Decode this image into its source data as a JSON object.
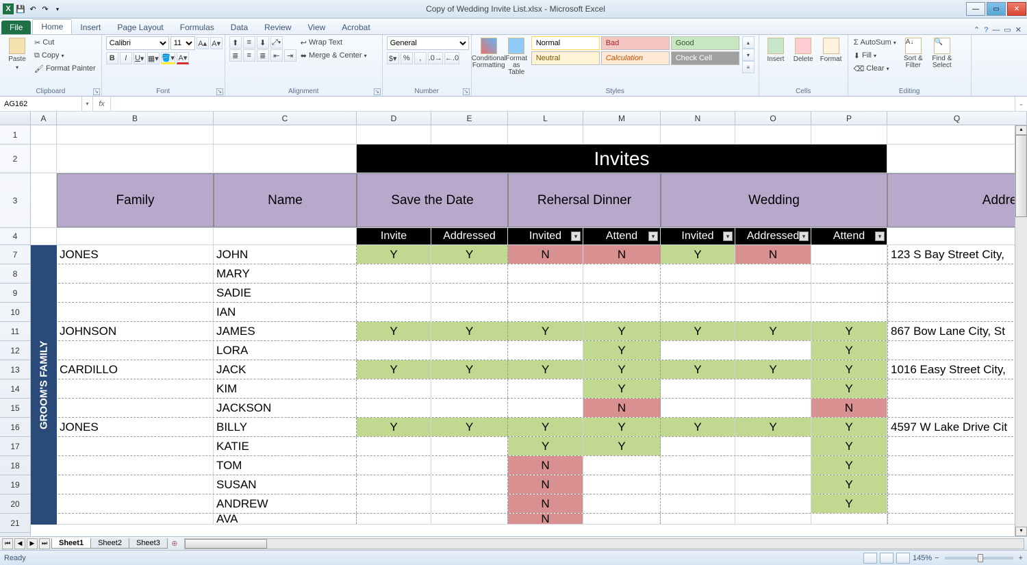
{
  "window": {
    "title": "Copy of Wedding Invite List.xlsx - Microsoft Excel"
  },
  "tabs": {
    "file": "File",
    "list": [
      "Home",
      "Insert",
      "Page Layout",
      "Formulas",
      "Data",
      "Review",
      "View",
      "Acrobat"
    ],
    "active": "Home"
  },
  "ribbon": {
    "clipboard": {
      "label": "Clipboard",
      "paste": "Paste",
      "cut": "Cut",
      "copy": "Copy",
      "fmt": "Format Painter"
    },
    "font": {
      "label": "Font",
      "name": "Calibri",
      "size": "11"
    },
    "align": {
      "label": "Alignment",
      "wrap": "Wrap Text",
      "merge": "Merge & Center"
    },
    "number": {
      "label": "Number",
      "format": "General"
    },
    "styles": {
      "label": "Styles",
      "cond": "Conditional Formatting",
      "table": "Format as Table",
      "normal": "Normal",
      "bad": "Bad",
      "good": "Good",
      "neutral": "Neutral",
      "calc": "Calculation",
      "check": "Check Cell"
    },
    "cells": {
      "label": "Cells",
      "insert": "Insert",
      "delete": "Delete",
      "format": "Format"
    },
    "editing": {
      "label": "Editing",
      "autosum": "AutoSum",
      "fill": "Fill",
      "clear": "Clear",
      "sort": "Sort & Filter",
      "find": "Find & Select"
    }
  },
  "namebox": "AG162",
  "colheaders": [
    "A",
    "B",
    "C",
    "D",
    "E",
    "L",
    "M",
    "N",
    "O",
    "P",
    "Q"
  ],
  "rowheaders": [
    "1",
    "2",
    "3",
    "4",
    "7",
    "8",
    "9",
    "10",
    "11",
    "12",
    "13",
    "14",
    "15",
    "16",
    "17",
    "18",
    "19",
    "20",
    "21"
  ],
  "rowheights": {
    "r1": 28,
    "r2": 42,
    "r3": 80,
    "r4": 25,
    "data": 28
  },
  "sheet": {
    "invitesTitle": "Invites",
    "hdrFamily": "Family",
    "hdrName": "Name",
    "hdrSave": "Save the Date",
    "hdrReh": "Rehersal Dinner",
    "hdrWed": "Wedding",
    "hdrAddr": "Addres",
    "subInvite": "Invite",
    "subAddressed": "Addressed",
    "subInvited": "Invited",
    "subAttend": "Attend",
    "sideband": "GROOM'S FAMILY",
    "rows": [
      {
        "family": "JONES",
        "name": "JOHN",
        "d": "Y",
        "e": "Y",
        "l": "N",
        "m": "N",
        "n": "Y",
        "o": "N",
        "p": "",
        "addr": "123 S Bay Street City,"
      },
      {
        "family": "",
        "name": "MARY",
        "d": "",
        "e": "",
        "l": "",
        "m": "",
        "n": "",
        "o": "",
        "p": "",
        "addr": ""
      },
      {
        "family": "",
        "name": "SADIE",
        "d": "",
        "e": "",
        "l": "",
        "m": "",
        "n": "",
        "o": "",
        "p": "",
        "addr": ""
      },
      {
        "family": "",
        "name": "IAN",
        "d": "",
        "e": "",
        "l": "",
        "m": "",
        "n": "",
        "o": "",
        "p": "",
        "addr": ""
      },
      {
        "family": "JOHNSON",
        "name": "JAMES",
        "d": "Y",
        "e": "Y",
        "l": "Y",
        "m": "Y",
        "n": "Y",
        "o": "Y",
        "p": "Y",
        "addr": "867 Bow Lane City, St"
      },
      {
        "family": "",
        "name": "LORA",
        "d": "",
        "e": "",
        "l": "",
        "m": "Y",
        "n": "",
        "o": "",
        "p": "Y",
        "addr": ""
      },
      {
        "family": "CARDILLO",
        "name": "JACK",
        "d": "Y",
        "e": "Y",
        "l": "Y",
        "m": "Y",
        "n": "Y",
        "o": "Y",
        "p": "Y",
        "addr": "1016 Easy Street City,"
      },
      {
        "family": "",
        "name": "KIM",
        "d": "",
        "e": "",
        "l": "",
        "m": "Y",
        "n": "",
        "o": "",
        "p": "Y",
        "addr": ""
      },
      {
        "family": "",
        "name": "JACKSON",
        "d": "",
        "e": "",
        "l": "",
        "m": "N",
        "n": "",
        "o": "",
        "p": "N",
        "addr": ""
      },
      {
        "family": "JONES",
        "name": "BILLY",
        "d": "Y",
        "e": "Y",
        "l": "Y",
        "m": "Y",
        "n": "Y",
        "o": "Y",
        "p": "Y",
        "addr": "4597 W Lake Drive Cit"
      },
      {
        "family": "",
        "name": "KATIE",
        "d": "",
        "e": "",
        "l": "Y",
        "m": "Y",
        "n": "",
        "o": "",
        "p": "Y",
        "addr": ""
      },
      {
        "family": "",
        "name": "TOM",
        "d": "",
        "e": "",
        "l": "N",
        "m": "",
        "n": "",
        "o": "",
        "p": "Y",
        "addr": ""
      },
      {
        "family": "",
        "name": "SUSAN",
        "d": "",
        "e": "",
        "l": "N",
        "m": "",
        "n": "",
        "o": "",
        "p": "Y",
        "addr": ""
      },
      {
        "family": "",
        "name": "ANDREW",
        "d": "",
        "e": "",
        "l": "N",
        "m": "",
        "n": "",
        "o": "",
        "p": "Y",
        "addr": ""
      },
      {
        "family": "",
        "name": "AVA",
        "d": "",
        "e": "",
        "l": "N",
        "m": "",
        "n": "",
        "o": "",
        "p": "",
        "addr": ""
      }
    ]
  },
  "sheets": {
    "list": [
      "Sheet1",
      "Sheet2",
      "Sheet3"
    ],
    "active": "Sheet1"
  },
  "status": {
    "ready": "Ready",
    "zoom": "145%"
  }
}
